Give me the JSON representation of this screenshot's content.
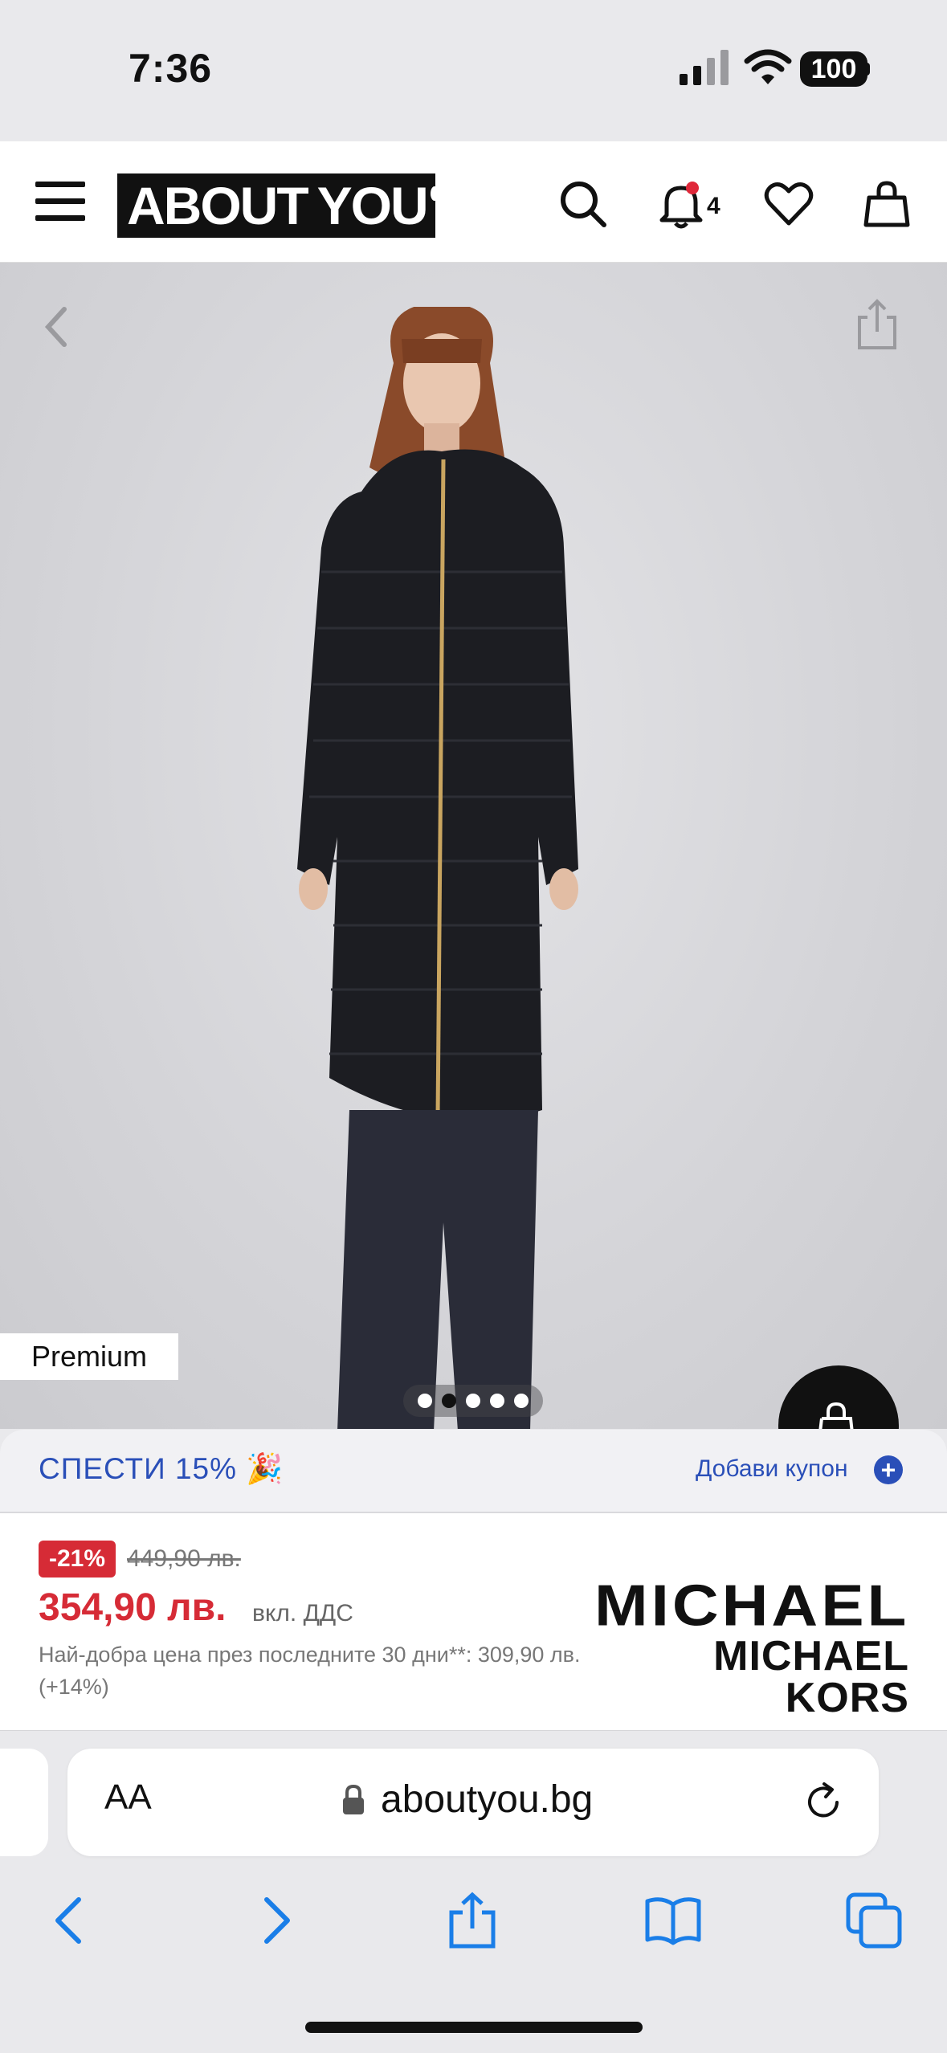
{
  "status_bar": {
    "time": "7:36",
    "battery": "100"
  },
  "header": {
    "logo_left": "ABOUT",
    "logo_right": "YOU",
    "notification_count": "4"
  },
  "product": {
    "premium_label": "Premium",
    "carousel": {
      "total": 5,
      "active_index": 1
    }
  },
  "coupon": {
    "promo_text": "СПЕСТИ 15% 🎉",
    "add_coupon_label": "Добави купон",
    "plus": "+"
  },
  "price": {
    "discount": "-21%",
    "old_price": "449,90 лв.",
    "current_price": "354,90 лв.",
    "vat_label": "вкл. ДДС",
    "best_price_note": "Най-добра цена през последните 30 дни**: 309,90 лв. (+14%)",
    "brand_line1": "MICHAEL",
    "brand_line2": "MICHAEL KORS"
  },
  "browser": {
    "text_size_label": "AA",
    "url": "aboutyou.bg"
  },
  "colors": {
    "accent_blue": "#2a4fb8",
    "sale_red": "#d62b36",
    "safari_blue": "#1a7ee8"
  }
}
